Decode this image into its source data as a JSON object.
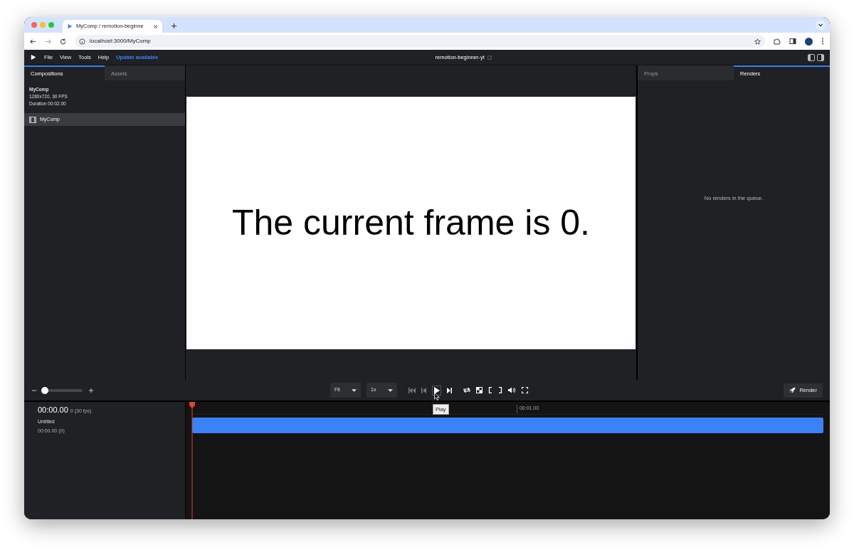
{
  "browser": {
    "tab_title": "MyComp / remotion-beginne",
    "url": "localhost:3000/MyComp"
  },
  "menu": [
    {
      "label": "File"
    },
    {
      "label": "View"
    },
    {
      "label": "Tools"
    },
    {
      "label": "Help"
    }
  ],
  "update_label": "Update available",
  "project_title": "remotion-beginner-yt",
  "left_tabs": [
    {
      "label": "Compositions",
      "selected": true
    },
    {
      "label": "Assets",
      "selected": false
    }
  ],
  "composition": {
    "name": "MyComp",
    "size": "1280x720, 30 FPS",
    "duration": "Duration 00:02.00"
  },
  "composition_list": [
    {
      "label": "MyComp",
      "selected": true
    }
  ],
  "canvas_text": "The current frame is 0.",
  "right_tabs": [
    {
      "label": "Props",
      "selected": false
    },
    {
      "label": "Renders",
      "selected": true
    }
  ],
  "renders_empty": "No renders in the queue.",
  "toolbar": {
    "zoom": {
      "level": 0.0
    },
    "size_select": "Fit",
    "rate_select": "1x",
    "tooltip": "Play",
    "render_button": "Render"
  },
  "timeline": {
    "time": "00:00.00",
    "frame": "0 (30 fps)",
    "track_name": "Untitled",
    "track_time": "00:00.00 (0)",
    "tick_label": "00:01.00",
    "playhead": {
      "level": 0.0
    }
  }
}
